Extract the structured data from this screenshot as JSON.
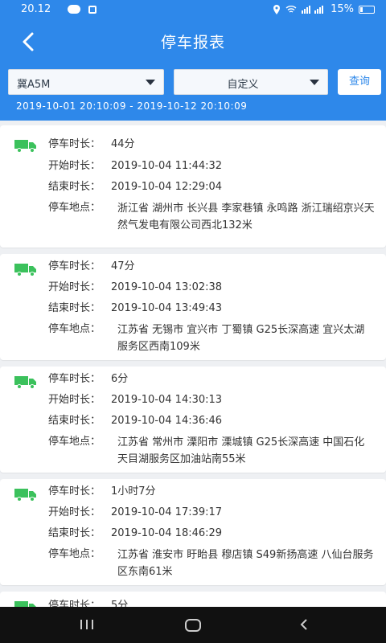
{
  "status": {
    "time": "20.12",
    "battery": "15%"
  },
  "header": {
    "title": "停车报表",
    "back_label": ""
  },
  "filters": {
    "vehicle": "冀A5M",
    "period": "自定义",
    "query_label": "查询",
    "date_range": "2019-10-01 20:10:09  -  2019-10-12 20:10:09"
  },
  "labels": {
    "duration": "停车时长：",
    "start": "开始时长：",
    "end": "结束时长：",
    "location": "停车地点："
  },
  "records": [
    {
      "duration": "44分",
      "start": "2019-10-04 11:44:32",
      "end": "2019-10-04 12:29:04",
      "location": "浙江省 湖州市 长兴县 李家巷镇 永鸣路 浙江瑞绍京兴天然气发电有限公司西北132米"
    },
    {
      "duration": "47分",
      "start": "2019-10-04 13:02:38",
      "end": "2019-10-04 13:49:43",
      "location": "江苏省 无锡市 宜兴市 丁蜀镇 G25长深高速 宜兴太湖服务区西南109米"
    },
    {
      "duration": "6分",
      "start": "2019-10-04 14:30:13",
      "end": "2019-10-04 14:36:46",
      "location": "江苏省 常州市 溧阳市 溧城镇 G25长深高速 中国石化天目湖服务区加油站南55米"
    },
    {
      "duration": "1小时7分",
      "start": "2019-10-04 17:39:17",
      "end": "2019-10-04 18:46:29",
      "location": "江苏省 淮安市 盱眙县 穆店镇 S49新扬高速 八仙台服务区东南61米"
    },
    {
      "duration": "5分",
      "start": "",
      "end": "",
      "location": ""
    }
  ],
  "colors": {
    "header": "#2e88ea",
    "truck": "#3bc15c"
  }
}
